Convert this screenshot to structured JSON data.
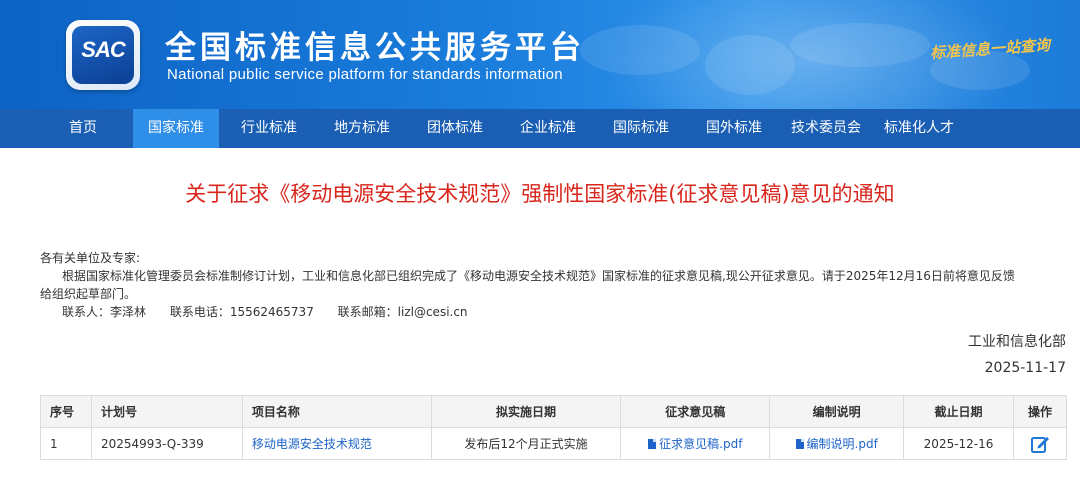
{
  "header": {
    "logo_text": "SAC",
    "title": "全国标准信息公共服务平台",
    "subtitle": "National public service platform  for standards information",
    "slogan": "标准信息一站查询"
  },
  "nav": {
    "items": [
      {
        "label": "首页",
        "active": false
      },
      {
        "label": "国家标准",
        "active": true
      },
      {
        "label": "行业标准",
        "active": false
      },
      {
        "label": "地方标准",
        "active": false
      },
      {
        "label": "团体标准",
        "active": false
      },
      {
        "label": "企业标准",
        "active": false
      },
      {
        "label": "国际标准",
        "active": false
      },
      {
        "label": "国外标准",
        "active": false
      },
      {
        "label": "技术委员会",
        "active": false
      },
      {
        "label": "标准化人才",
        "active": false
      }
    ]
  },
  "notice": {
    "title": "关于征求《移动电源安全技术规范》强制性国家标准(征求意见稿)意见的通知",
    "salutation": "各有关单位及专家:",
    "paragraph_line1": "根据国家标准化管理委员会标准制修订计划，工业和信息化部已组织完成了《移动电源安全技术规范》国家标准的征求意见稿,现公开征求意见。请于2025年12月16日前将意见反馈",
    "paragraph_line2": "给组织起草部门。",
    "contact_person": "联系人：李泽林",
    "contact_phone": "联系电话：15562465737",
    "contact_email": "联系邮箱：lizl@cesi.cn",
    "issuer": "工业和信息化部",
    "date": "2025-11-17"
  },
  "table": {
    "headers": [
      "序号",
      "计划号",
      "项目名称",
      "拟实施日期",
      "征求意见稿",
      "编制说明",
      "截止日期",
      "操作"
    ],
    "rows": [
      {
        "index": "1",
        "plan_no": "20254993-Q-339",
        "project": "移动电源安全技术规范",
        "implement": "发布后12个月正式实施",
        "draft": "征求意见稿.pdf",
        "explain": "编制说明.pdf",
        "deadline": "2025-12-16",
        "action_icon": "edit-icon"
      }
    ]
  },
  "colors": {
    "header_blue": "#1a7ddc",
    "nav_blue": "#1a5fb4",
    "nav_active": "#2f8ee8",
    "title_red": "#d9261c",
    "link_blue": "#1e64c8"
  }
}
